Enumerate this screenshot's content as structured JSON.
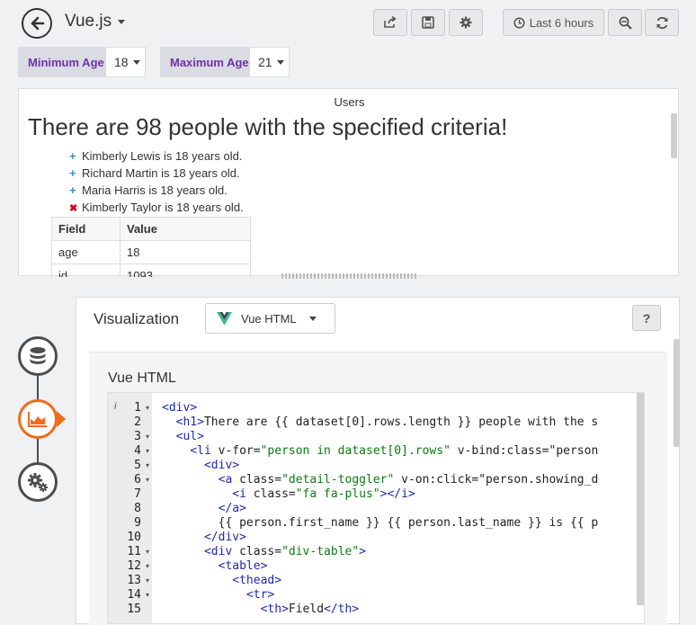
{
  "header": {
    "title": "Vue.js",
    "time_range_label": "Last 6 hours"
  },
  "variables": [
    {
      "label": "Minimum Age",
      "value": "18"
    },
    {
      "label": "Maximum Age",
      "value": "21"
    }
  ],
  "panel": {
    "title": "Users",
    "heading": "There are 98 people with the specified criteria!",
    "people": [
      {
        "text": "Kimberly Lewis is 18 years old.",
        "mark": "+",
        "mark_color": "#3a8ddb"
      },
      {
        "text": "Richard Martin is 18 years old.",
        "mark": "+",
        "mark_color": "#3a8ddb"
      },
      {
        "text": "Maria Harris is 18 years old.",
        "mark": "+",
        "mark_color": "#3a8ddb"
      },
      {
        "text": "Kimberly Taylor is 18 years old.",
        "mark": "✖",
        "mark_color": "#d0021b"
      }
    ],
    "table": {
      "headers": [
        "Field",
        "Value"
      ],
      "rows": [
        [
          "age",
          "18"
        ],
        [
          "id",
          "1093"
        ]
      ]
    }
  },
  "editor": {
    "visualization_label": "Visualization",
    "viz_type": "Vue HTML",
    "help_label": "?",
    "section_title": "Vue HTML",
    "info_marker": "i",
    "line_numbers": [
      "1",
      "2",
      "3",
      "4",
      "5",
      "6",
      "7",
      "8",
      "9",
      "10",
      "11",
      "12",
      "13",
      "14",
      "15"
    ],
    "code": [
      {
        "ln": "1",
        "fold": true,
        "text": "<div>"
      },
      {
        "ln": "2",
        "fold": false,
        "text": "  <h1>There are {{ dataset[0].rows.length }} people with the s"
      },
      {
        "ln": "3",
        "fold": true,
        "text": "  <ul>"
      },
      {
        "ln": "4",
        "fold": true,
        "text": "    <li v-for=\"person in dataset[0].rows\" v-bind:class=\"person"
      },
      {
        "ln": "5",
        "fold": true,
        "text": "      <div>"
      },
      {
        "ln": "6",
        "fold": true,
        "text": "        <a class=\"detail-toggler\" v-on:click=\"person.showing_d"
      },
      {
        "ln": "7",
        "fold": false,
        "text": "          <i class=\"fa fa-plus\"></i>"
      },
      {
        "ln": "8",
        "fold": false,
        "text": "        </a>"
      },
      {
        "ln": "9",
        "fold": false,
        "text": "        {{ person.first_name }} {{ person.last_name }} is {{ p"
      },
      {
        "ln": "10",
        "fold": false,
        "text": "      </div>"
      },
      {
        "ln": "11",
        "fold": true,
        "text": "      <div class=\"div-table\">"
      },
      {
        "ln": "12",
        "fold": true,
        "text": "        <table>"
      },
      {
        "ln": "13",
        "fold": true,
        "text": "          <thead>"
      },
      {
        "ln": "14",
        "fold": true,
        "text": "            <tr>"
      },
      {
        "ln": "15",
        "fold": false,
        "text": "              <th>Field</th>"
      }
    ]
  },
  "colors": {
    "accent_orange": "#f26a1b",
    "purple_label": "#6e33a6",
    "vue_green": "#41b883"
  }
}
